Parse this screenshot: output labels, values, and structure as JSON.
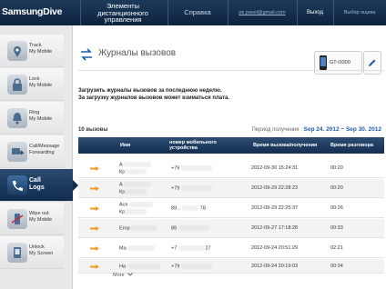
{
  "topbar": {
    "logo": "SamsungDive",
    "app_title": [
      "Элементы",
      "дистанционного",
      "управления"
    ],
    "help": "Справка",
    "email": "pk.pavel@gmail.com",
    "logout": "Выход",
    "device_select": "Выбор ящика"
  },
  "sidebar": {
    "items": [
      {
        "line1": "Track",
        "line2": "My Mobile",
        "icon": "track-icon"
      },
      {
        "line1": "Lock",
        "line2": "My Mobile",
        "icon": "lock-icon"
      },
      {
        "line1": "Ring",
        "line2": "My Mobile",
        "icon": "ring-icon"
      },
      {
        "line1": "Call/Message",
        "line2": "Forwarding",
        "icon": "forwarding-icon"
      },
      {
        "line1": "Call",
        "line2": "Logs",
        "icon": "call-logs-icon",
        "active": true
      },
      {
        "line1": "Wipe out",
        "line2": "My Mobile",
        "icon": "wipe-icon"
      },
      {
        "line1": "Unlock",
        "line2": "My Screen",
        "icon": "unlock-icon"
      }
    ]
  },
  "main": {
    "title": "Журналы вызовов",
    "device_name": "GT-I9300",
    "notice_line1": "Загрузить журналы вызовов за последнюю неделю.",
    "notice_line2": "За загрузку журналов вызовов может взиматься плата.",
    "count": "10 вызовы",
    "period_label": "Период получения :",
    "period_value": "Sep 24. 2012 ~ Sep 30. 2012",
    "more": "More"
  },
  "table": {
    "headers": {
      "name": "Имя",
      "number": [
        "номер мобильного",
        "устройства"
      ],
      "time": "Время вызова/получения",
      "duration": "Время разговора"
    },
    "rows": [
      {
        "name1": "А",
        "name2": "Кр",
        "number": "+79",
        "time": "2012-09-30 15:24:31",
        "duration": "00:20"
      },
      {
        "name1": "А",
        "name2": "Кр",
        "number": "+79",
        "time": "2012-09-29 22:28:23",
        "duration": "00:20"
      },
      {
        "name1": "Ася",
        "name2": "Кр",
        "number": "89...",
        "number_tail": "78",
        "time": "2012-09-29 22:25:37",
        "duration": "00:26"
      },
      {
        "name1": "Егор",
        "name2": "",
        "number": "89",
        "time": "2012-09-27 17:18:28",
        "duration": "00:33"
      },
      {
        "name1": "Ма",
        "name2": "",
        "number": "+7",
        "number_tail": "27",
        "time": "2012-09-24 20:51:29",
        "duration": "02:21"
      },
      {
        "name1": "На",
        "name2": "",
        "number": "+79",
        "time": "2012-09-24 20:19:03",
        "duration": "00:34"
      }
    ]
  },
  "colors": {
    "topbar": "#0d2340",
    "accent_orange": "#f39a1e",
    "link_blue": "#1f5ca8"
  }
}
